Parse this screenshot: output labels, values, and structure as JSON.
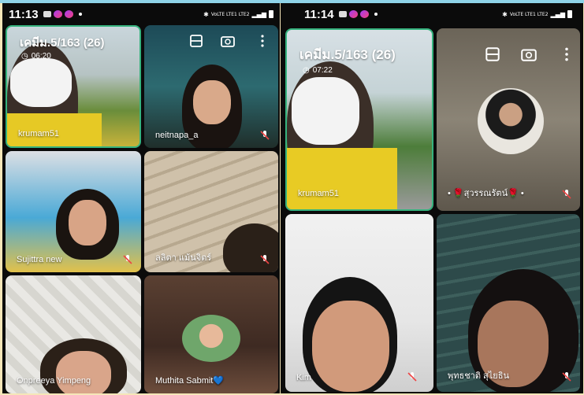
{
  "left_phone": {
    "time": "11:13",
    "network_label": "VoLTE LTE1 LTE2",
    "meeting_title": "เคมีม.5/163 (26)",
    "duration": "06:20",
    "participants": [
      {
        "name": "krumam51",
        "muted": false
      },
      {
        "name": "neitnapa_a",
        "muted": true
      },
      {
        "name": "Sujittra new",
        "muted": true
      },
      {
        "name": "ลลิตา แม้นจิตร์",
        "muted": true
      },
      {
        "name": "Onpreeya Yimpeng",
        "muted": false
      },
      {
        "name": "Muthita  Sabmit💙",
        "muted": false
      }
    ]
  },
  "right_phone": {
    "time": "11:14",
    "network_label": "VoLTE LTE1 LTE2",
    "meeting_title": "เคมีม.5/163 (26)",
    "duration": "07:22",
    "participants": [
      {
        "name": "krumam51",
        "muted": false
      },
      {
        "name": "• 🌹สุวรรณรัตน์🌹 •",
        "muted": true
      },
      {
        "name": "Kim",
        "muted": true
      },
      {
        "name": "พุทธชาติ สุไยธิน",
        "muted": true
      }
    ]
  },
  "colors": {
    "active_border": "#36b37e",
    "background": "#f5e6b8"
  },
  "icons": [
    "layout-icon",
    "flip-camera-icon",
    "more-icon",
    "mic-off-icon",
    "clock-icon"
  ]
}
